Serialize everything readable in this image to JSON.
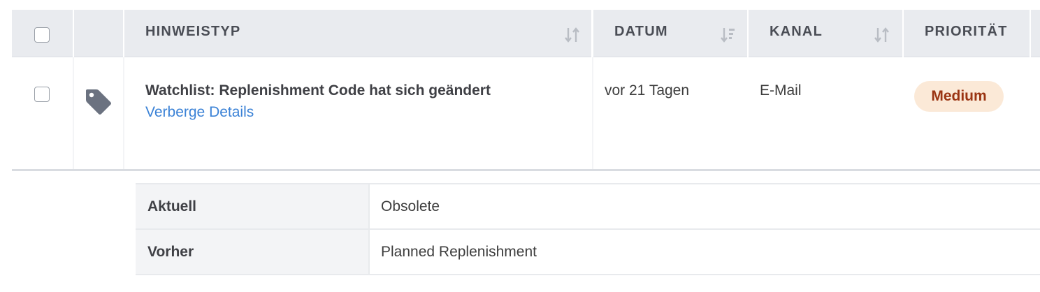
{
  "table": {
    "headers": {
      "hinweistyp": "HINWEISTYP",
      "datum": "DATUM",
      "kanal": "KANAL",
      "prioritaet": "PRIORITÄT"
    },
    "rows": [
      {
        "icon": "tag-icon",
        "title": "Watchlist: Replenishment Code hat sich geändert",
        "toggle_link": "Verberge Details",
        "date": "vor 21 Tagen",
        "channel": "E-Mail",
        "priority": "Medium"
      }
    ]
  },
  "details": {
    "rows": [
      {
        "label": "Aktuell",
        "value": "Obsolete"
      },
      {
        "label": "Vorher",
        "value": "Planned Replenishment"
      }
    ]
  },
  "colors": {
    "header_bg": "#e9ebef",
    "link": "#3b82d6",
    "badge_bg": "#fbe9d7",
    "badge_text": "#9a3412",
    "detail_label_bg": "#f3f4f6"
  }
}
